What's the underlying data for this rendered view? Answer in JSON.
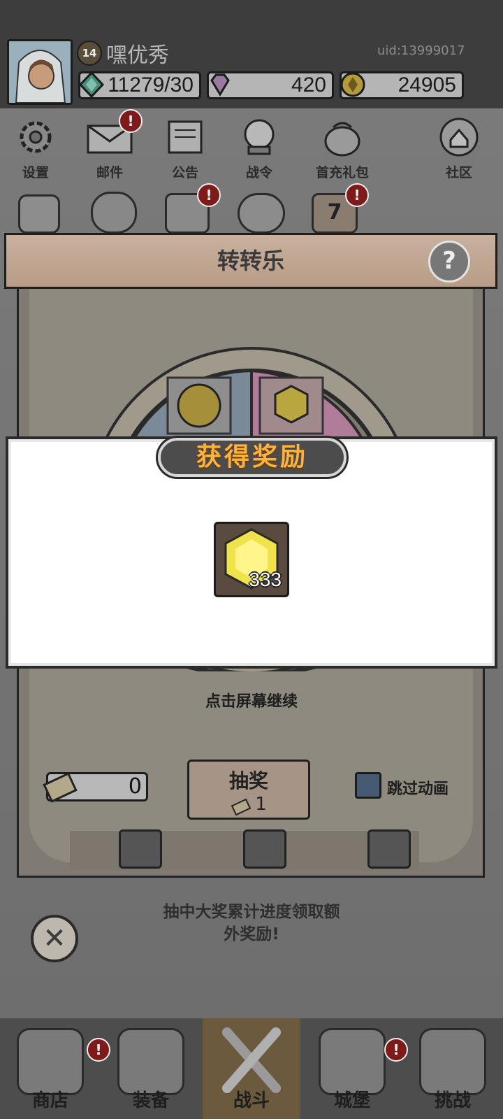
{
  "player": {
    "level": "14",
    "name": "嘿优秀",
    "uid": "uid:13999017"
  },
  "resources": {
    "stamina": "11279/30",
    "gems": "420",
    "coins": "24905"
  },
  "menu": {
    "row1": [
      {
        "label": "设置",
        "icon": "gear-icon",
        "badge": false
      },
      {
        "label": "邮件",
        "icon": "mail-icon",
        "badge": true
      },
      {
        "label": "公告",
        "icon": "scroll-icon",
        "badge": false
      },
      {
        "label": "战令",
        "icon": "crystal-ball-icon",
        "badge": false
      },
      {
        "label": "首充礼包",
        "icon": "gift-bag-icon",
        "badge": false
      }
    ],
    "community": "社区",
    "row2_badges": [
      "!",
      "!"
    ],
    "row2_level": "7"
  },
  "panel": {
    "title": "转转乐",
    "help": "?",
    "ticket_count": "0",
    "draw_label": "抽奖",
    "draw_cost": "1",
    "skip_label": "跳过动画",
    "milestone_text_line1": "抽中大奖累计进度领取额",
    "milestone_text_line2": "外奖励!"
  },
  "reward": {
    "title": "获得奖励",
    "item_icon": "yellow-gem-icon",
    "quantity": "333",
    "continue_hint": "点击屏幕继续"
  },
  "nav": [
    {
      "label": "商店",
      "icon": "shop-icon",
      "badge": "!"
    },
    {
      "label": "装备",
      "icon": "backpack-icon",
      "badge": ""
    },
    {
      "label": "战斗",
      "icon": "crossed-swords-icon",
      "badge": ""
    },
    {
      "label": "城堡",
      "icon": "castle-icon",
      "badge": "!"
    },
    {
      "label": "挑战",
      "icon": "shield-icon",
      "badge": ""
    }
  ],
  "badge_mark": "!",
  "colors": {
    "reward_title": "#ffb23c",
    "badge_red": "#7e1a1a",
    "checkbox_blue": "#465a73"
  }
}
